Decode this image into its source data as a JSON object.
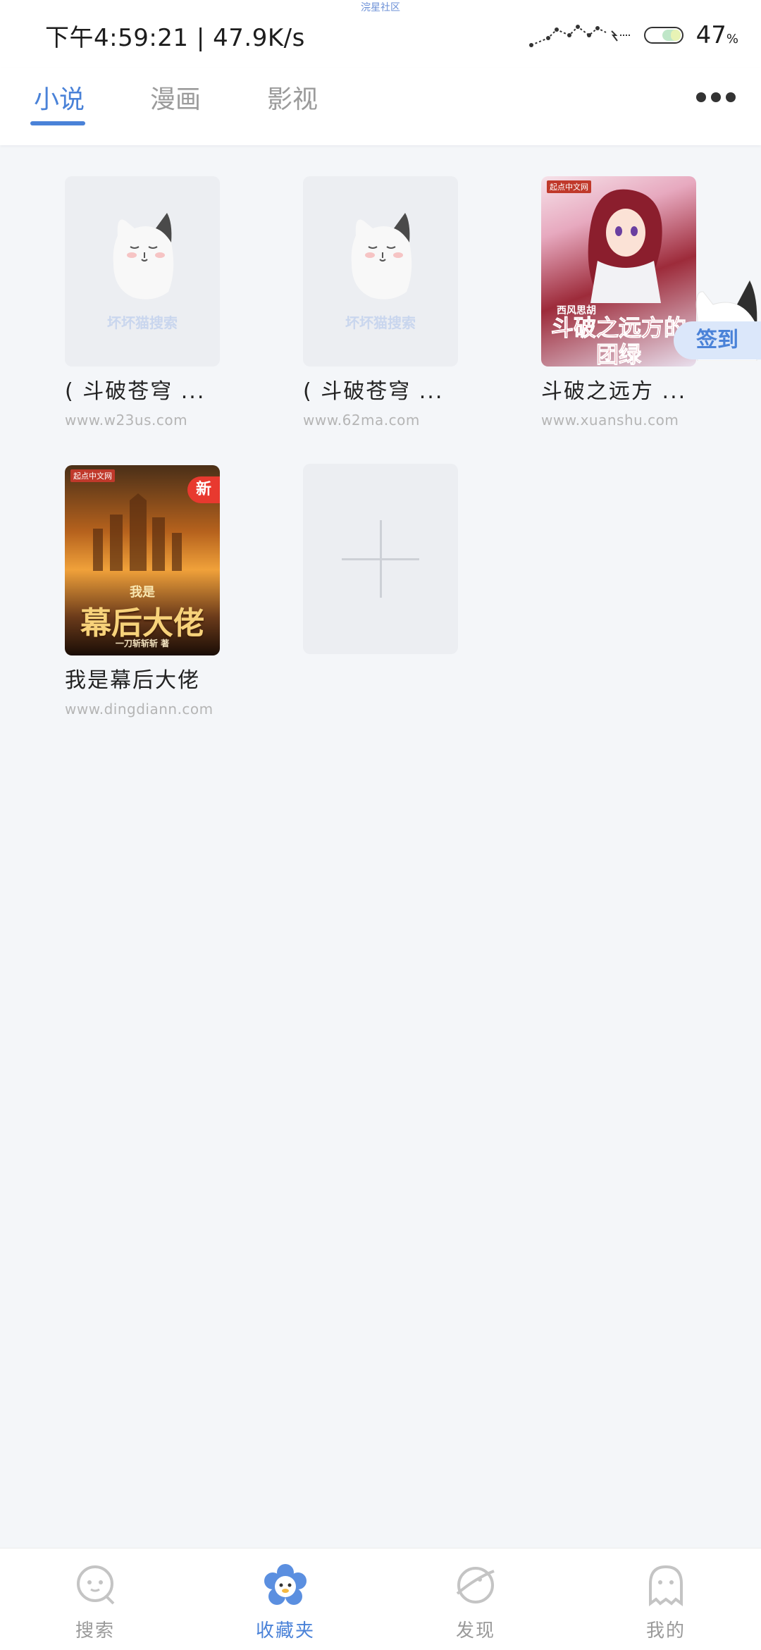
{
  "status_bar": {
    "notification_label": "浣星社区",
    "time_speed": "下午4:59:21 | 47.9K/s",
    "battery_percent": "47",
    "battery_unit": "%"
  },
  "tabs": [
    {
      "label": "小说",
      "active": true
    },
    {
      "label": "漫画",
      "active": false
    },
    {
      "label": "影视",
      "active": false
    }
  ],
  "placeholder_text": "坏坏猫搜索",
  "books": [
    {
      "title": "( 斗破苍穹 ...",
      "source": "www.w23us.com",
      "cover": "placeholder"
    },
    {
      "title": "( 斗破苍穹 ...",
      "source": "www.62ma.com",
      "cover": "placeholder"
    },
    {
      "title": "斗破之远方 ...",
      "source": "www.xuanshu.com",
      "cover": "art",
      "cover_title": "斗破之远方的团绿",
      "cover_author": "西风思胡",
      "cover_publisher": "起点中文网"
    },
    {
      "title": "我是幕后大佬",
      "source": "www.dingdiann.com",
      "cover": "art",
      "cover_title_small": "我是",
      "cover_title_big": "幕后大佬",
      "cover_author": "一刀斩斩斩 著",
      "cover_publisher": "起点中文网",
      "badge": "新"
    }
  ],
  "checkin_label": "签到",
  "bottom_nav": [
    {
      "label": "搜索",
      "icon": "search-face-icon",
      "active": false
    },
    {
      "label": "收藏夹",
      "icon": "flower-chick-icon",
      "active": true
    },
    {
      "label": "发现",
      "icon": "planet-icon",
      "active": false
    },
    {
      "label": "我的",
      "icon": "ghost-profile-icon",
      "active": false
    }
  ],
  "colors": {
    "accent": "#4a82d8",
    "background": "#f4f6f9",
    "inactive_text": "#9b9b9b",
    "badge_red": "#e8392f"
  }
}
